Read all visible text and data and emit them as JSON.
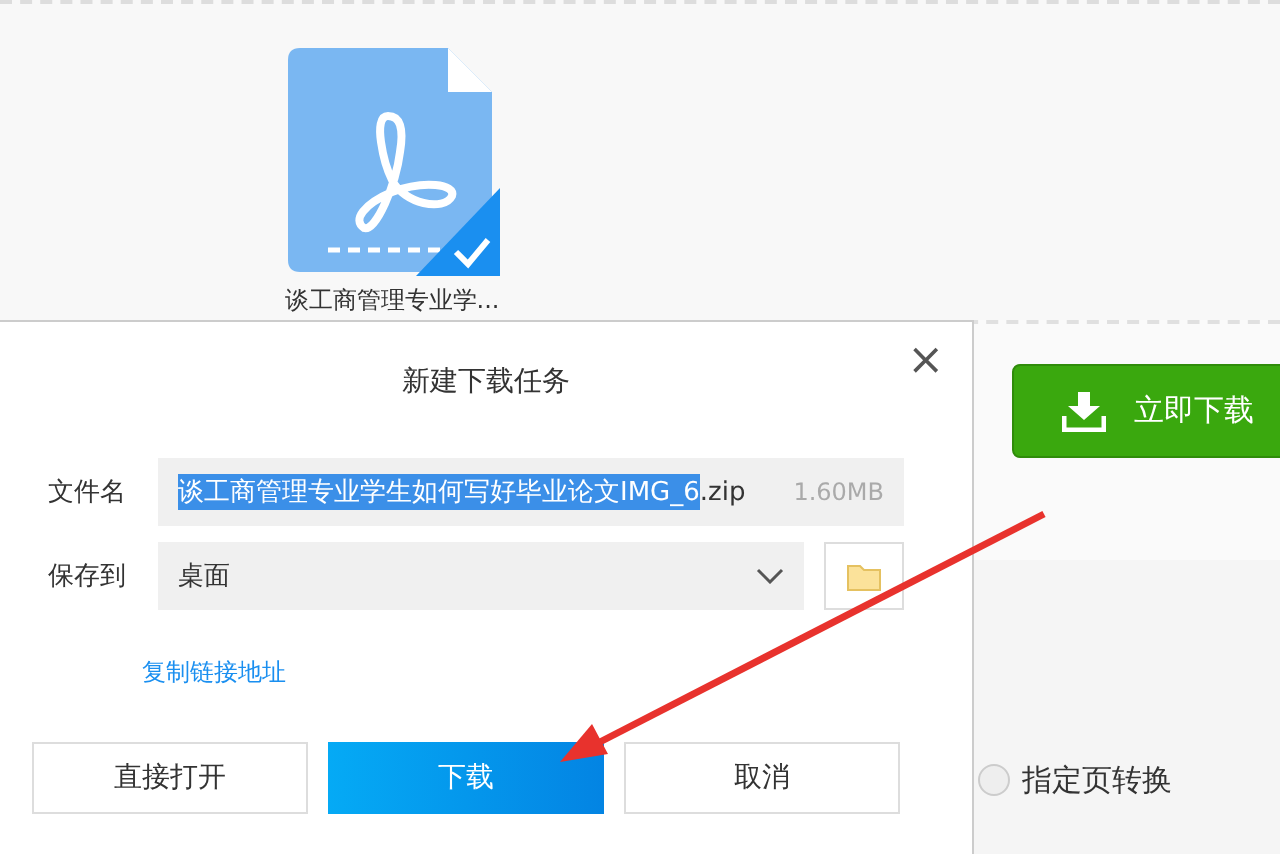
{
  "file_card": {
    "name": "谈工商管理专业学...",
    "selected": true
  },
  "download_now_button": {
    "label": "立即下载"
  },
  "page_convert_option": {
    "label": "指定页转换",
    "selected": false
  },
  "dialog": {
    "title": "新建下载任务",
    "close": "×",
    "filename_label": "文件名",
    "filename_selected": "谈工商管理专业学生如何写好毕业论文IMG_6",
    "filename_rest": ".zip",
    "file_size": "1.60MB",
    "save_label": "保存到",
    "save_location": "桌面",
    "copy_link": "复制链接地址",
    "buttons": [
      {
        "label": "直接打开",
        "kind": "plain"
      },
      {
        "label": "下载",
        "kind": "primary"
      },
      {
        "label": "取消",
        "kind": "plain"
      }
    ]
  }
}
